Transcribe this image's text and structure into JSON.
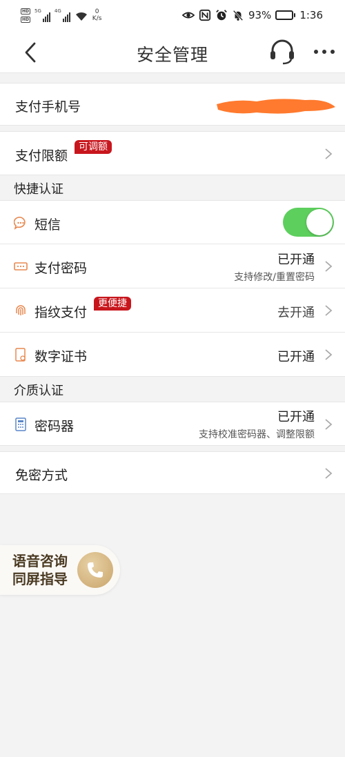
{
  "status_bar": {
    "signal1_tag": "5G",
    "signal2_tag": "4G",
    "net_speed_value": "0",
    "net_speed_unit": "K/s",
    "battery_percent": "93%",
    "battery_level": 0.93,
    "time": "1:36"
  },
  "nav": {
    "title": "安全管理"
  },
  "rows": {
    "pay_phone": {
      "label": "支付手机号"
    },
    "pay_limit": {
      "label": "支付限额",
      "badge": "可调额"
    },
    "sms": {
      "label": "短信",
      "toggle_on": true
    },
    "pay_password": {
      "label": "支付密码",
      "value": "已开通",
      "sub": "支持修改/重置密码"
    },
    "fingerprint": {
      "label": "指纹支付",
      "badge": "更便捷",
      "value": "去开通"
    },
    "digital_cert": {
      "label": "数字证书",
      "value": "已开通"
    },
    "token": {
      "label": "密码器",
      "value": "已开通",
      "sub": "支持校准密码器、调整限额"
    },
    "password_free": {
      "label": "免密方式"
    }
  },
  "sections": {
    "quick_auth": "快捷认证",
    "medium_auth": "介质认证"
  },
  "voice_assist": {
    "line1": "语音咨询",
    "line2": "同屏指导"
  },
  "colors": {
    "badge_red": "#c8161d",
    "toggle_green": "#5dcf5d",
    "icon_orange": "#e8874e",
    "gold": "#c9a46a",
    "redaction_orange": "#ff7a2e"
  }
}
